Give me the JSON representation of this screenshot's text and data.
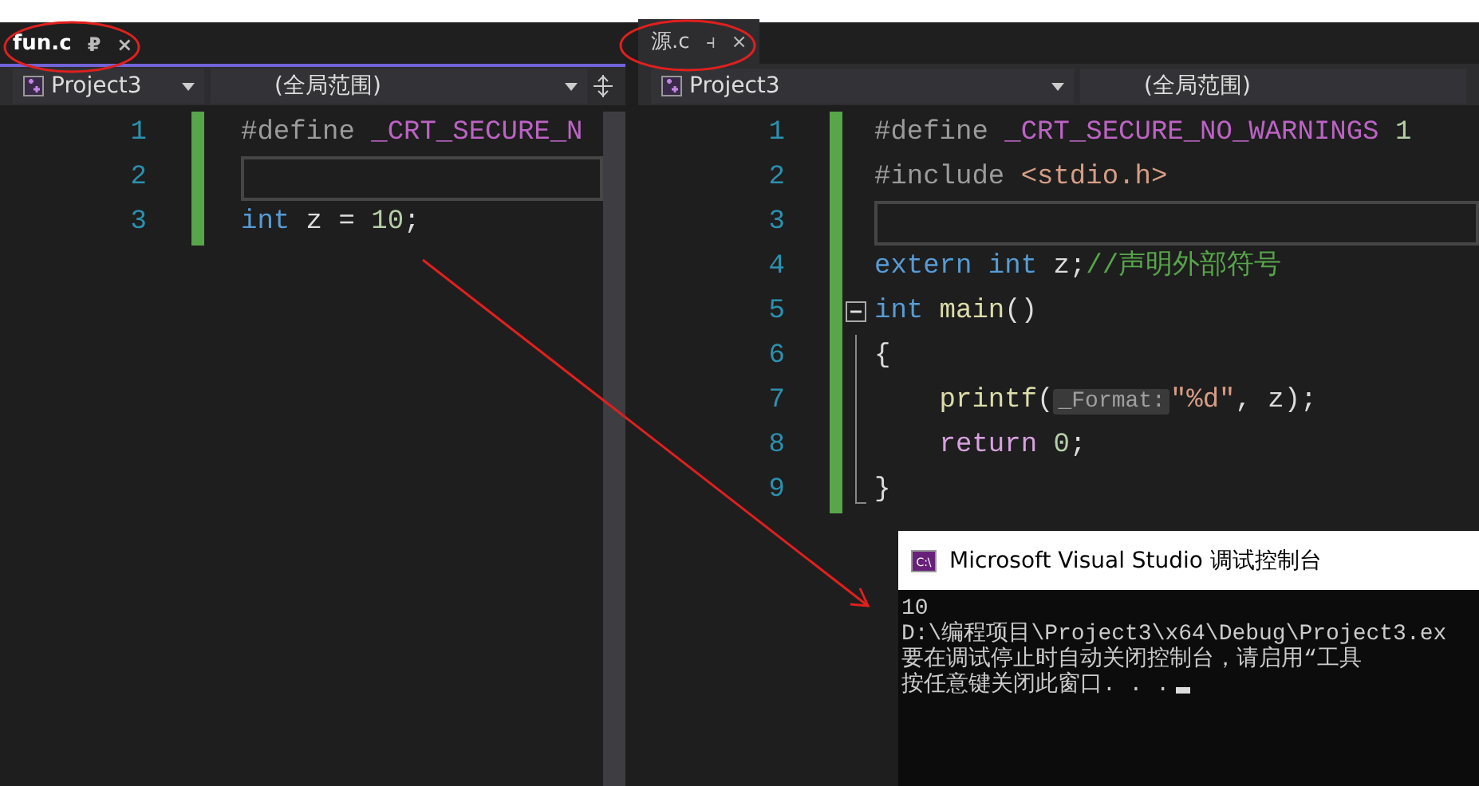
{
  "panes": [
    {
      "tab": {
        "label": "fun.c",
        "selected": true,
        "pin": "₽",
        "close": "×"
      },
      "project": "Project3",
      "scope": "(全局范围)",
      "lines": [
        {
          "number": "1",
          "current": false,
          "tokens": [
            {
              "text": "#define",
              "kind": "preproc"
            },
            {
              "text": " _CRT_SECURE_N",
              "kind": "macro"
            }
          ]
        },
        {
          "number": "2",
          "current": true
        },
        {
          "number": "3",
          "current": false,
          "tokens": [
            {
              "text": "int",
              "kind": "keyword"
            },
            {
              "text": " z = ",
              "kind": "plain"
            },
            {
              "text": "10",
              "kind": "number"
            },
            {
              "text": ";",
              "kind": "plain"
            }
          ]
        }
      ]
    },
    {
      "tab": {
        "label": "源.c",
        "selected": false,
        "pin": "⫞",
        "close": "×"
      },
      "project": "Project3",
      "scope": "(全局范围)",
      "lines": [
        {
          "number": "1",
          "current": false,
          "tokens": [
            {
              "text": "#define",
              "kind": "preproc"
            },
            {
              "text": " _CRT_SECURE_NO_WARNINGS",
              "kind": "macro"
            },
            {
              "text": " 1",
              "kind": "number"
            }
          ]
        },
        {
          "number": "2",
          "current": false,
          "tokens": [
            {
              "text": "#include",
              "kind": "preproc"
            },
            {
              "text": " <stdio.h>",
              "kind": "string"
            }
          ]
        },
        {
          "number": "3",
          "current": true
        },
        {
          "number": "4",
          "current": false,
          "tokens": [
            {
              "text": "extern",
              "kind": "keyword"
            },
            {
              "text": " int",
              "kind": "keyword"
            },
            {
              "text": " z;",
              "kind": "plain"
            },
            {
              "text": "//声明外部符号",
              "kind": "comment"
            }
          ]
        },
        {
          "number": "5",
          "current": false,
          "collapsible": true,
          "tokens": [
            {
              "text": "int",
              "kind": "keyword"
            },
            {
              "text": " main",
              "kind": "func"
            },
            {
              "text": "()",
              "kind": "plain"
            }
          ]
        },
        {
          "number": "6",
          "current": false,
          "in_block": true,
          "tokens": [
            {
              "text": "{",
              "kind": "plain"
            }
          ]
        },
        {
          "number": "7",
          "current": false,
          "in_block": true,
          "tokens": [
            {
              "text": "    printf",
              "kind": "func"
            },
            {
              "text": "(",
              "kind": "plain"
            },
            {
              "text": "_Format:",
              "kind": "hint"
            },
            {
              "text": "\"%d\"",
              "kind": "string"
            },
            {
              "text": ", z);",
              "kind": "plain"
            }
          ]
        },
        {
          "number": "8",
          "current": false,
          "in_block": true,
          "tokens": [
            {
              "text": "    return",
              "kind": "control"
            },
            {
              "text": " 0",
              "kind": "number"
            },
            {
              "text": ";",
              "kind": "plain"
            }
          ]
        },
        {
          "number": "9",
          "current": false,
          "in_block": true,
          "block_end": true,
          "tokens": [
            {
              "text": "}",
              "kind": "plain"
            }
          ]
        }
      ]
    }
  ],
  "console": {
    "icon_text": "C:\\",
    "title": "Microsoft Visual Studio 调试控制台",
    "lines": [
      "10",
      "D:\\编程项目\\Project3\\x64\\Debug\\Project3.ex",
      "要在调试停止时自动关闭控制台，请启用“工具",
      "按任意键关闭此窗口. . ."
    ]
  }
}
